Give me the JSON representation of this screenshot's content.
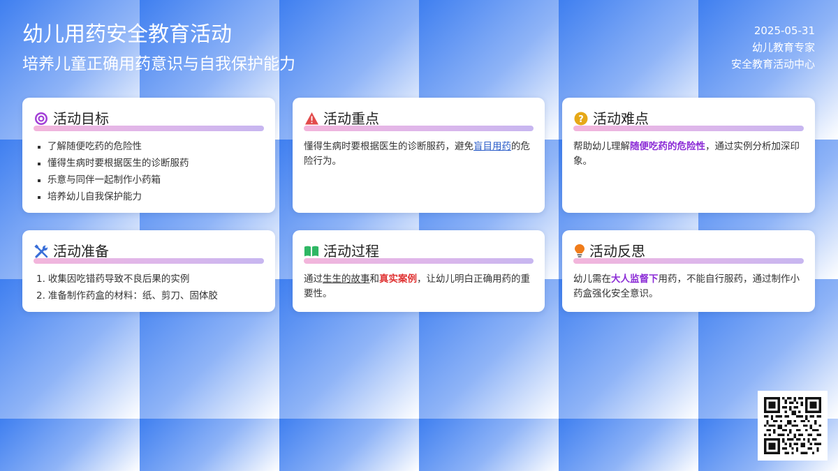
{
  "header": {
    "title": "幼儿用药安全教育活动",
    "subtitle": "培养儿童正确用药意识与自我保护能力"
  },
  "meta": {
    "date": "2025-05-31",
    "author": "幼儿教育专家",
    "organization": "安全教育活动中心"
  },
  "cards": {
    "goal": {
      "icon": "target-icon",
      "title": "活动目标",
      "items": [
        "了解随便吃药的危险性",
        "懂得生病时要根据医生的诊断服药",
        "乐意与同伴一起制作小药箱",
        "培养幼儿自我保护能力"
      ]
    },
    "focus": {
      "icon": "warning-icon",
      "title": "活动重点",
      "text_before": "懂得生病时要根据医生的诊断服药，避免",
      "link": "盲目用药",
      "text_after": "的危险行为。"
    },
    "difficulty": {
      "icon": "question-icon",
      "title": "活动难点",
      "text_before": "帮助幼儿理解",
      "highlight": "随便吃药的危险性",
      "text_after": "，通过实例分析加深印象。"
    },
    "preparation": {
      "icon": "tools-icon",
      "title": "活动准备",
      "items": [
        {
          "num": "1.",
          "text": "收集因吃错药导致不良后果的实例"
        },
        {
          "num": "2.",
          "text": "准备制作药盒的材料：纸、剪刀、固体胶"
        }
      ]
    },
    "process": {
      "icon": "book-icon",
      "title": "活动过程",
      "text_before": "通过",
      "underlined": "生生的故事",
      "text_middle": "和",
      "highlight": "真实案例",
      "text_after": "，让幼儿明白正确用药的重要性。"
    },
    "reflection": {
      "icon": "lightbulb-icon",
      "title": "活动反思",
      "text_before": "幼儿需在",
      "highlight": "大人监督下",
      "text_after": "用药，不能自行服药，通过制作小药盒强化安全意识。"
    }
  },
  "qr": {
    "icon": "qr-code-icon"
  },
  "colors": {
    "accent_blue": "#3f7ff0",
    "highlight_purple": "#8b2bd6",
    "highlight_red": "#e03535",
    "link_blue": "#2a5cc8"
  }
}
